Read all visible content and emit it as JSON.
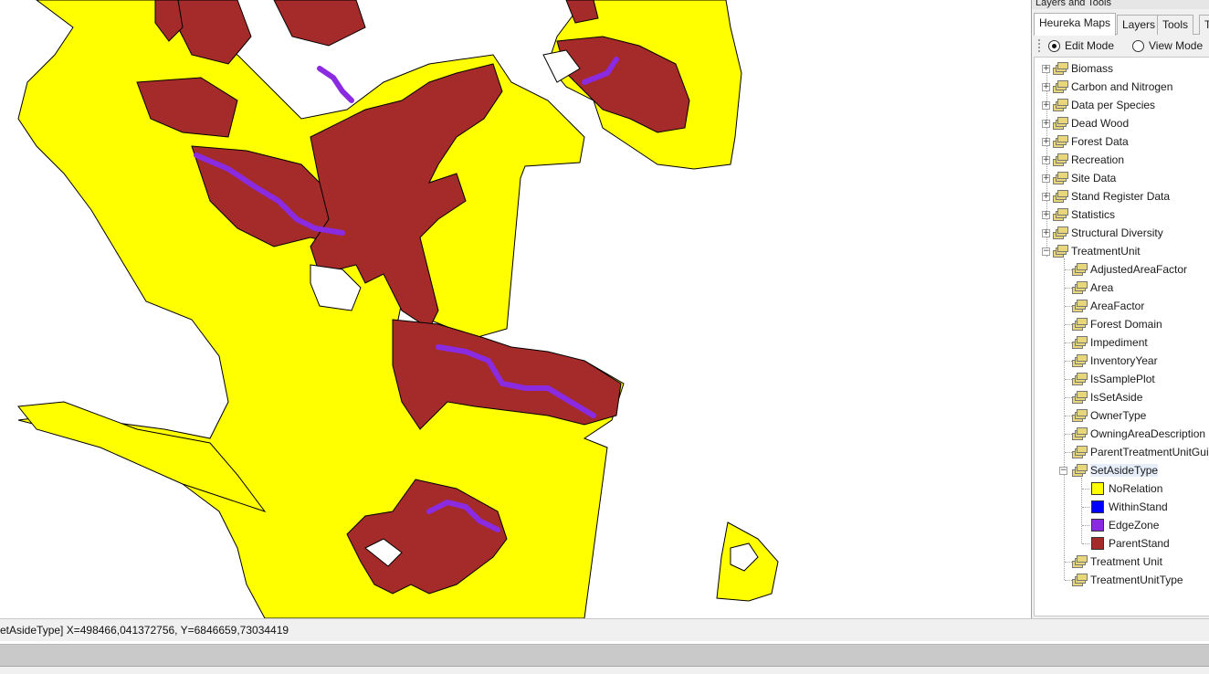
{
  "panel": {
    "title": "Layers and Tools",
    "tabs": [
      {
        "label": "Heureka Maps",
        "active": true
      },
      {
        "label": "Layers",
        "active": false
      },
      {
        "label": "Tools",
        "active": false
      },
      {
        "label": "T",
        "active": false
      }
    ],
    "modes": [
      {
        "label": "Edit Mode",
        "selected": true
      },
      {
        "label": "View Mode",
        "selected": false
      }
    ],
    "tree": {
      "groups": [
        {
          "label": "Biomass",
          "expanded": false,
          "icon": "layer-group-icon"
        },
        {
          "label": "Carbon and Nitrogen",
          "expanded": false,
          "icon": "layer-group-icon"
        },
        {
          "label": "Data per Species",
          "expanded": false,
          "icon": "layer-group-icon"
        },
        {
          "label": "Dead Wood",
          "expanded": false,
          "icon": "layer-group-icon"
        },
        {
          "label": "Forest Data",
          "expanded": false,
          "icon": "layer-group-icon"
        },
        {
          "label": "Recreation",
          "expanded": false,
          "icon": "layer-group-icon"
        },
        {
          "label": "Site Data",
          "expanded": false,
          "icon": "layer-group-icon"
        },
        {
          "label": "Stand Register Data",
          "expanded": false,
          "icon": "layer-group-icon"
        },
        {
          "label": "Statistics",
          "expanded": false,
          "icon": "layer-group-icon"
        },
        {
          "label": "Structural Diversity",
          "expanded": false,
          "icon": "layer-group-icon"
        },
        {
          "label": "TreatmentUnit",
          "expanded": true,
          "icon": "layer-group-icon"
        }
      ],
      "treatment_unit_children": [
        {
          "label": "AdjustedAreaFactor"
        },
        {
          "label": "Area"
        },
        {
          "label": "AreaFactor"
        },
        {
          "label": "Forest Domain"
        },
        {
          "label": "Impediment"
        },
        {
          "label": "InventoryYear"
        },
        {
          "label": "IsSamplePlot"
        },
        {
          "label": "IsSetAside"
        },
        {
          "label": "OwnerType"
        },
        {
          "label": "OwningAreaDescription"
        },
        {
          "label": "ParentTreatmentUnitGuid"
        },
        {
          "label": "SetAsideType",
          "expanded": true,
          "selected": true
        },
        {
          "label": "Treatment Unit"
        },
        {
          "label": "TreatmentUnitType"
        }
      ],
      "legend": [
        {
          "label": "NoRelation",
          "color": "#ffff00"
        },
        {
          "label": "WithinStand",
          "color": "#0000ff"
        },
        {
          "label": "EdgeZone",
          "color": "#8a2be2"
        },
        {
          "label": "ParentStand",
          "color": "#a52a2a"
        }
      ]
    }
  },
  "status": {
    "coordinates": "etAsideType]  X=498466,041372756, Y=6846659,73034419"
  },
  "map": {
    "colors": {
      "no_relation": "#ffff00",
      "edge_zone": "#8a2be2",
      "parent_stand": "#a52a2a",
      "outline": "#000000",
      "background": "#ffffff"
    }
  }
}
